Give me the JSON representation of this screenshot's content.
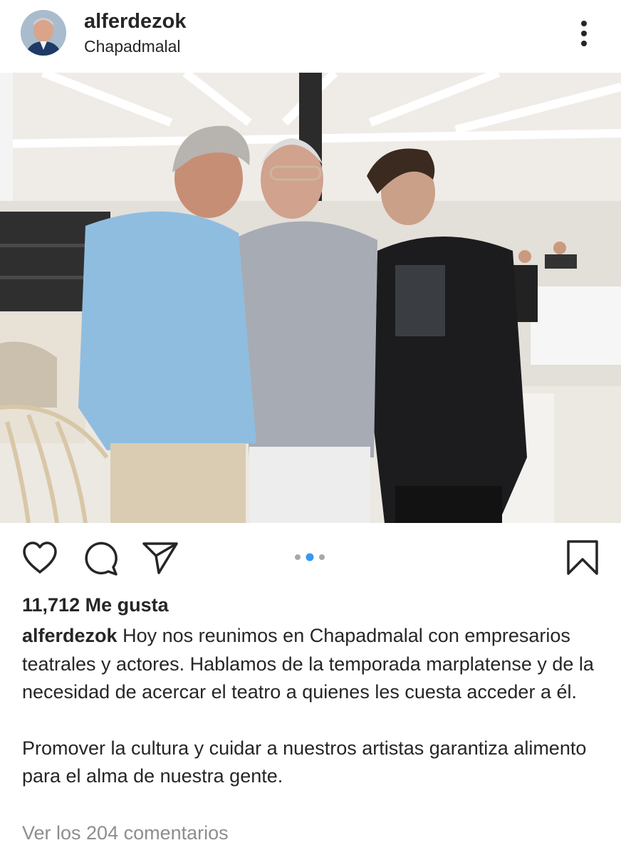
{
  "post": {
    "username": "alferdezok",
    "location": "Chapadmalal",
    "likes_text": "11,712 Me gusta",
    "caption_line1": "Hoy nos reunimos en Chapadmalal con empresarios teatrales y actores. Hablamos de la temporada marplatense y de la necesidad de acercar el teatro a quienes les cuesta acceder a él.",
    "caption_line2": "Promover la cultura y cuidar a nuestros artistas garantiza alimento para el alma de nuestra gente.",
    "comments_link": "Ver los 204 comentarios"
  },
  "carousel": {
    "total": 3,
    "active": 2
  },
  "icons": {
    "more": "more-vertical-icon",
    "like": "heart-icon",
    "comment": "comment-bubble-icon",
    "share": "paper-plane-icon",
    "save": "bookmark-icon"
  },
  "colors": {
    "text": "#262626",
    "muted": "#8e8e8e",
    "accent": "#3897f0"
  }
}
